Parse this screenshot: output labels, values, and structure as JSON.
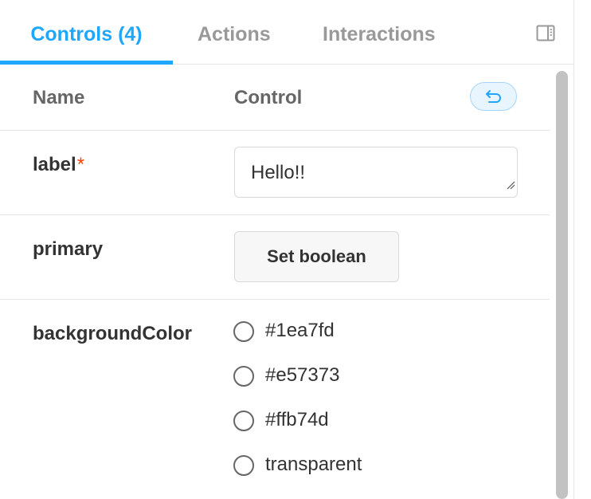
{
  "tabs": [
    {
      "label": "Controls (4)",
      "active": true
    },
    {
      "label": "Actions",
      "active": false
    },
    {
      "label": "Interactions",
      "active": false
    }
  ],
  "icons": {
    "panel_toggle": "sidebar-panel-icon",
    "reset": "undo-arrow-icon"
  },
  "table": {
    "headers": {
      "name": "Name",
      "control": "Control"
    }
  },
  "controls": {
    "label": {
      "name": "label",
      "required_marker": "*",
      "value": "Hello!!"
    },
    "primary": {
      "name": "primary",
      "button_label": "Set boolean"
    },
    "backgroundColor": {
      "name": "backgroundColor",
      "options": [
        "#1ea7fd",
        "#e57373",
        "#ffb74d",
        "transparent"
      ],
      "selected": null
    }
  },
  "colors": {
    "accent": "#1ea7fd",
    "required": "#ff4400",
    "muted_text": "#999999"
  }
}
